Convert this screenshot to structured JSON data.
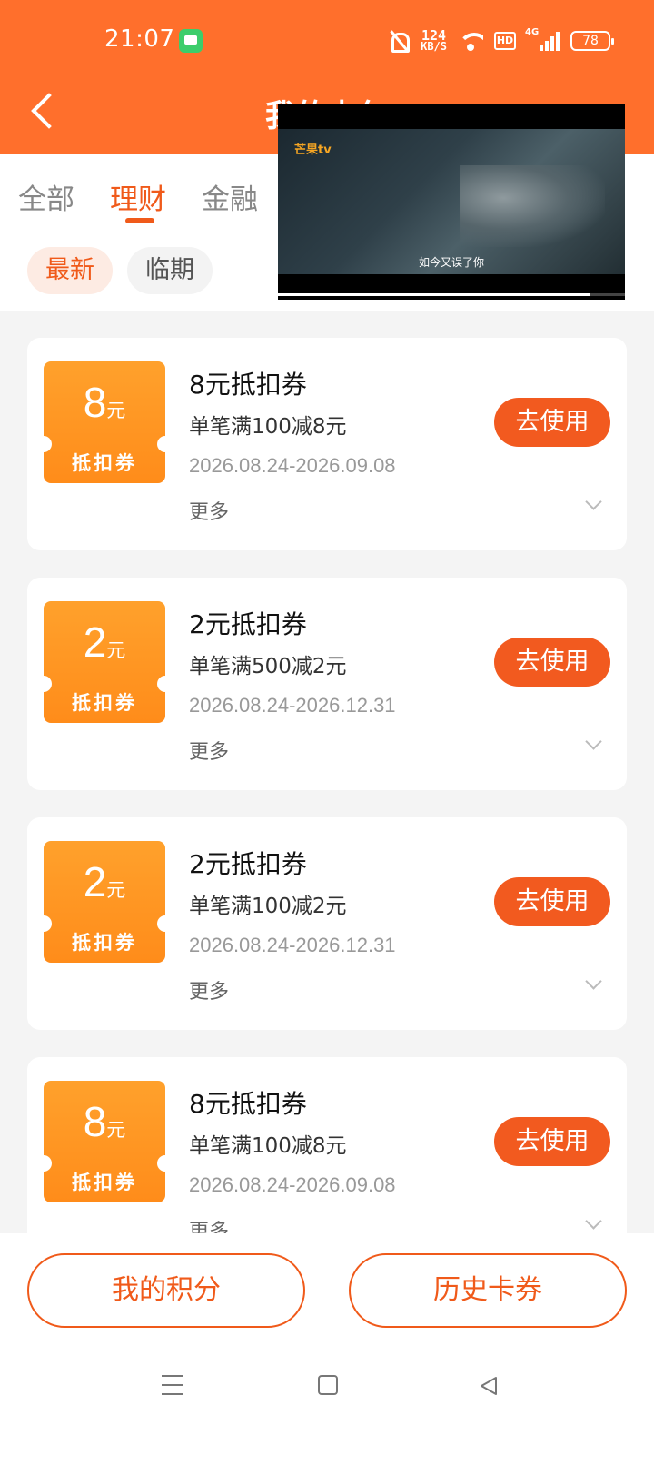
{
  "status_bar": {
    "time": "21:07",
    "net_speed_value": "124",
    "net_speed_unit": "KB/S",
    "hd": "HD",
    "network_type": "4G",
    "battery": "78"
  },
  "header": {
    "title": "我的卡包"
  },
  "tabs": [
    {
      "label": "全部"
    },
    {
      "label": "理财"
    },
    {
      "label": "金融"
    }
  ],
  "active_tab_index": 1,
  "filters": [
    {
      "label": "最新"
    },
    {
      "label": "临期"
    }
  ],
  "video_overlay": {
    "logo": "芒果tv",
    "subtitle": "如今又误了你",
    "progress": 0.9
  },
  "coupons": [
    {
      "amount": "8",
      "unit": "元",
      "ticket_label": "抵扣券",
      "title": "8元抵扣券",
      "condition": "单笔满100减8元",
      "date_range": "2026.08.24-2026.09.08",
      "more": "更多",
      "button": "去使用"
    },
    {
      "amount": "2",
      "unit": "元",
      "ticket_label": "抵扣券",
      "title": "2元抵扣券",
      "condition": "单笔满500减2元",
      "date_range": "2026.08.24-2026.12.31",
      "more": "更多",
      "button": "去使用"
    },
    {
      "amount": "2",
      "unit": "元",
      "ticket_label": "抵扣券",
      "title": "2元抵扣券",
      "condition": "单笔满100减2元",
      "date_range": "2026.08.24-2026.12.31",
      "more": "更多",
      "button": "去使用"
    },
    {
      "amount": "8",
      "unit": "元",
      "ticket_label": "抵扣券",
      "title": "8元抵扣券",
      "condition": "单笔满100减8元",
      "date_range": "2026.08.24-2026.09.08",
      "more": "更多",
      "button": "去使用"
    }
  ],
  "bottom_actions": {
    "points": "我的积分",
    "history": "历史卡券"
  },
  "colors": {
    "brand": "#ff6f2c",
    "accent": "#f05a1a",
    "ticket": "#ff8c1a"
  }
}
